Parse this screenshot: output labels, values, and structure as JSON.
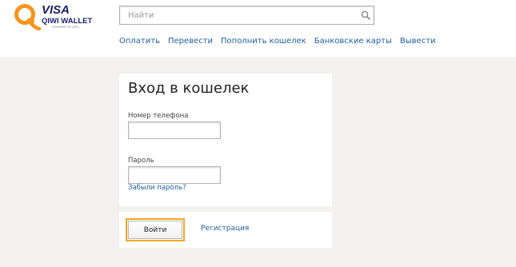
{
  "header": {
    "logo": {
      "brand_line1": "VISA",
      "brand_line2": "QIWI WALLET",
      "brand_line3": "POWERED BY QIPS",
      "icon": "qiwi-q-logo-icon",
      "colors": {
        "orange": "#f7941e",
        "blue": "#1a1f71",
        "gray": "#888888"
      }
    },
    "search": {
      "placeholder": "Найти",
      "value": "",
      "icon": "search-icon"
    },
    "nav": [
      {
        "label": "Оплатить"
      },
      {
        "label": "Перевести"
      },
      {
        "label": "Пополнить кошелек"
      },
      {
        "label": "Банковские карты"
      },
      {
        "label": "Вывести"
      }
    ]
  },
  "login": {
    "title": "Вход в кошелек",
    "phone": {
      "label": "Номер телефона",
      "value": "",
      "placeholder": ""
    },
    "password": {
      "label": "Пароль",
      "value": "",
      "placeholder": ""
    },
    "forgot_link": "Забыли пароль?",
    "login_button": "Войти",
    "register_link": "Регистрация"
  },
  "colors": {
    "page_background": "#f2f1ef",
    "link": "#1f5fa3",
    "focus_outline": "#f5a623"
  }
}
